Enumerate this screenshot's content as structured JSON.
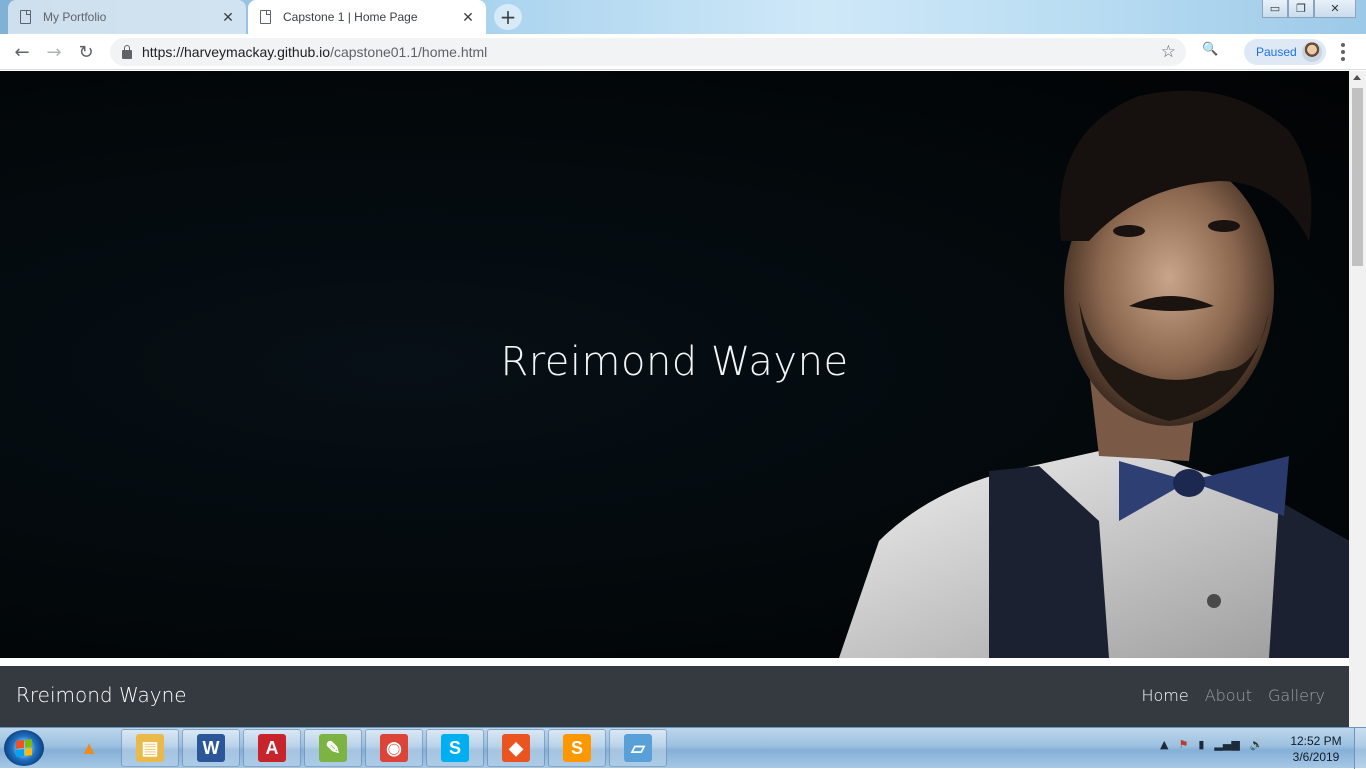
{
  "browser": {
    "tabs": [
      {
        "title": "My Portfolio",
        "close": "✕",
        "active": false
      },
      {
        "title": "Capstone 1 | Home Page",
        "close": "✕",
        "active": true
      }
    ],
    "new_tab": "+",
    "window_controls": {
      "minimize": "▭",
      "maximize": "❐",
      "close": "✕"
    },
    "nav": {
      "back": "←",
      "forward": "→",
      "reload": "↻"
    },
    "url": {
      "host": "https://harveymackay.github.io",
      "path": "/capstone01.1/home.html"
    },
    "bookmark_icon": "☆",
    "search_icon": "🔍",
    "profile_label": "Paused"
  },
  "page": {
    "hero_title": "Rreimond Wayne",
    "nav": {
      "brand": "Rreimond Wayne",
      "links": [
        {
          "label": "Home",
          "active": true
        },
        {
          "label": "About",
          "active": false
        },
        {
          "label": "Gallery",
          "active": false
        }
      ]
    }
  },
  "taskbar": {
    "apps": [
      {
        "name": "vlc",
        "glyph": "▲",
        "color": "#f08a1c"
      },
      {
        "name": "file-explorer",
        "glyph": "▤",
        "color": "#e9b949"
      },
      {
        "name": "word",
        "glyph": "W",
        "color": "#2b579a"
      },
      {
        "name": "autocad",
        "glyph": "A",
        "color": "#c8242c"
      },
      {
        "name": "notepad-plus-plus",
        "glyph": "✎",
        "color": "#7cb342"
      },
      {
        "name": "chrome",
        "glyph": "◉",
        "color": "#db4437"
      },
      {
        "name": "skype",
        "glyph": "S",
        "color": "#00aff0"
      },
      {
        "name": "git-extensions",
        "glyph": "◆",
        "color": "#e95420"
      },
      {
        "name": "sublime-text",
        "glyph": "S",
        "color": "#ff9800"
      },
      {
        "name": "snipping-tool",
        "glyph": "▱",
        "color": "#5aa0d8"
      }
    ],
    "tray": {
      "chevron": "▲",
      "flag": "⚑",
      "network": "▮",
      "signal": "▂▄▆",
      "volume": "🔊"
    },
    "clock": {
      "time": "12:52 PM",
      "date": "3/6/2019"
    }
  }
}
